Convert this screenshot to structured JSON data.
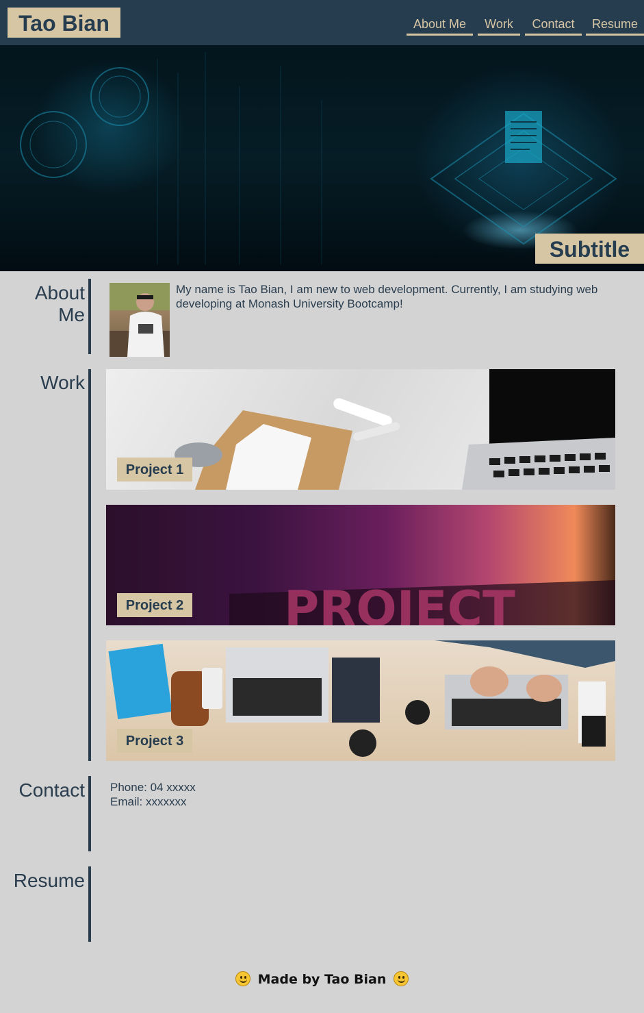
{
  "header": {
    "logo": "Tao Bian",
    "nav": [
      "About Me",
      "Work",
      "Contact",
      "Resume"
    ]
  },
  "hero": {
    "subtitle": "Subtitle"
  },
  "sections": {
    "about": {
      "heading_line1": "About",
      "heading_line2": "Me",
      "text": "My name is Tao Bian, I am new to web development. Currently, I am studying web developing at Monash University Bootcamp!"
    },
    "work": {
      "heading": "Work",
      "projects": [
        "Project 1",
        "Project 2",
        "Project 3"
      ]
    },
    "contact": {
      "heading": "Contact",
      "phone": "Phone: 04 xxxxx",
      "email": "Email: xxxxxxx"
    },
    "resume": {
      "heading": "Resume"
    }
  },
  "footer": {
    "text": "Made by Tao Bian"
  },
  "colors": {
    "header_bg": "#263d50",
    "accent": "#d7c6a4",
    "page_bg": "#d3d3d3",
    "text": "#2a3d4e"
  },
  "icons": [
    "smiley-icon"
  ]
}
